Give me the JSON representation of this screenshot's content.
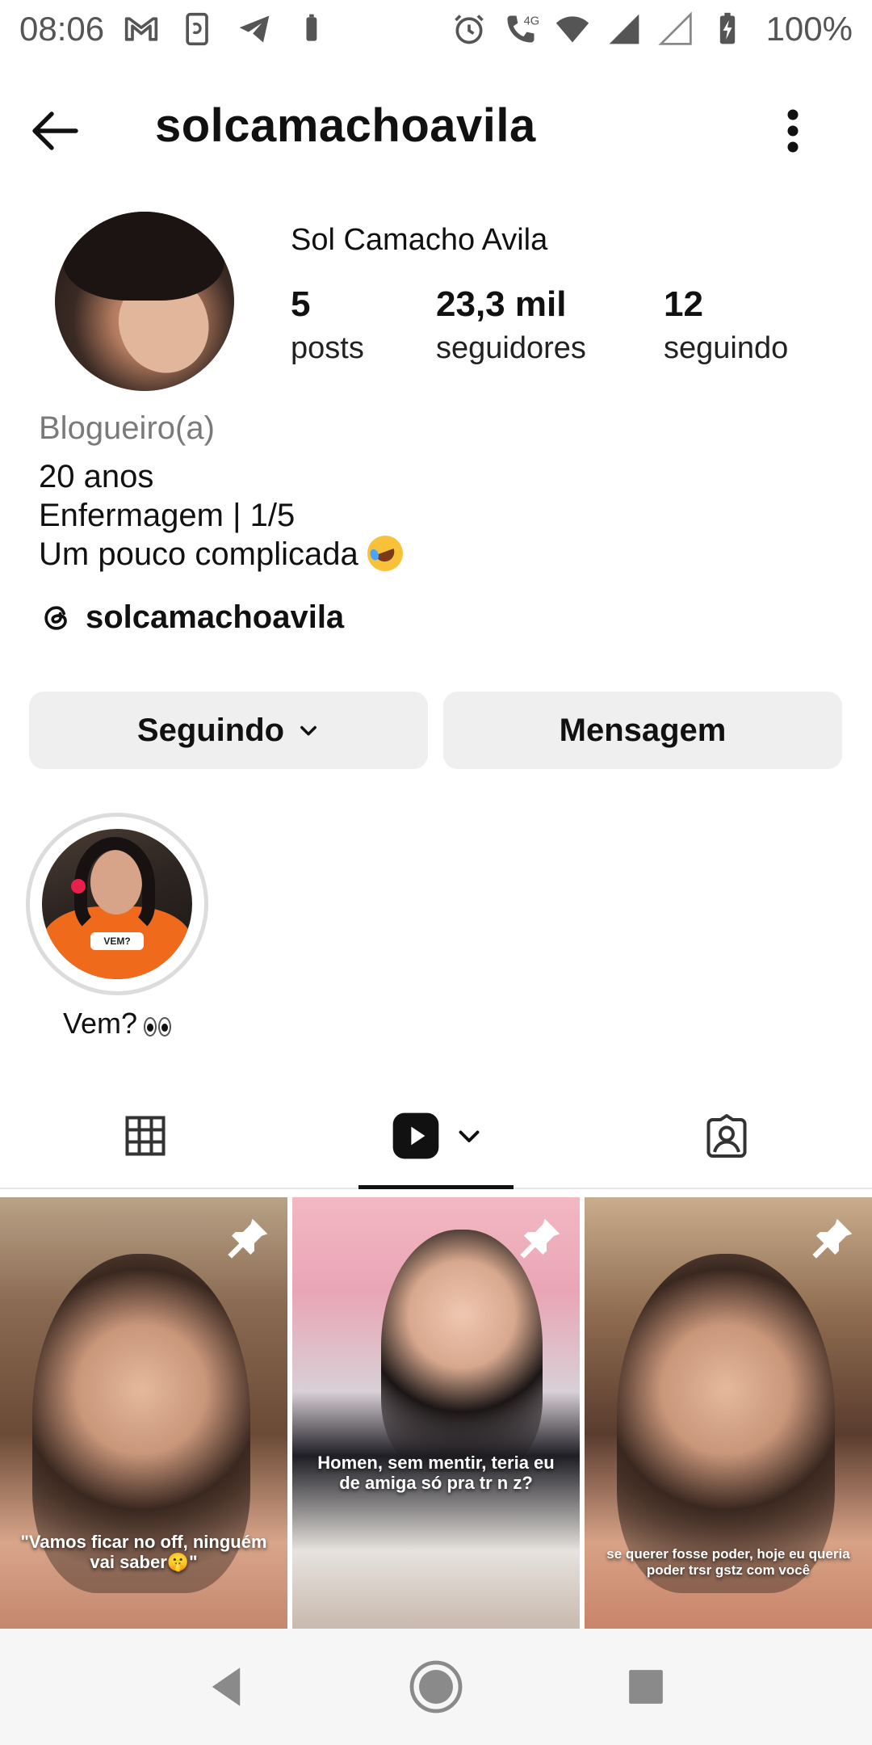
{
  "status_bar": {
    "time": "08:06",
    "network": "4G",
    "battery": "100%"
  },
  "header": {
    "username": "solcamachoavila"
  },
  "profile": {
    "display_name": "Sol Camacho Avila",
    "stats": {
      "posts": {
        "value": "5",
        "label": "posts"
      },
      "followers": {
        "value": "23,3 mil",
        "label": "seguidores"
      },
      "following": {
        "value": "12",
        "label": "seguindo"
      }
    },
    "category": "Blogueiro(a)",
    "bio": {
      "line1": "20 anos",
      "line2": "Enfermagem | 1/5",
      "line3": "Um pouco complicada"
    },
    "threads_handle": "solcamachoavila"
  },
  "actions": {
    "following_label": "Seguindo",
    "message_label": "Mensagem"
  },
  "highlights": [
    {
      "label": "Vem?",
      "sticker_text": "VEM?"
    }
  ],
  "tabs": [
    {
      "name": "grid",
      "icon": "grid-icon"
    },
    {
      "name": "reels",
      "icon": "reels-icon"
    },
    {
      "name": "tagged",
      "icon": "tagged-icon"
    }
  ],
  "posts": [
    {
      "caption": "\"Vamos ficar no off, ninguém vai saber🤫\"",
      "pinned": true
    },
    {
      "caption": "Homen, sem mentir, teria eu de amiga só pra tr n z?",
      "pinned": true
    },
    {
      "caption": "se querer fosse poder, hoje eu queria poder trsr gstz com você",
      "pinned": true
    }
  ],
  "colors": {
    "button_bg": "#efefef",
    "text": "#111111",
    "category_text": "#7a7a7a",
    "highlight_ring": "#dcdcdc"
  }
}
